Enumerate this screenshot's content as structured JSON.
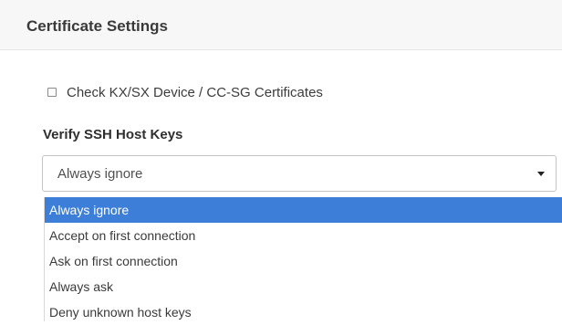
{
  "header": {
    "title": "Certificate Settings"
  },
  "certificate_check": {
    "label": "Check KX/SX Device / CC-SG Certificates",
    "checked": false
  },
  "ssh_host_keys": {
    "label": "Verify SSH Host Keys",
    "selected_value": "Always ignore",
    "options": [
      "Always ignore",
      "Accept on first connection",
      "Ask on first connection",
      "Always ask",
      "Deny unknown host keys"
    ],
    "highlighted_option": "Always ignore",
    "icons": {
      "dropdown": "chevron-down-icon",
      "checkbox": "checkbox-icon"
    }
  },
  "colors": {
    "highlight": "#3d7fd8",
    "header_bg": "#f7f7f7"
  }
}
